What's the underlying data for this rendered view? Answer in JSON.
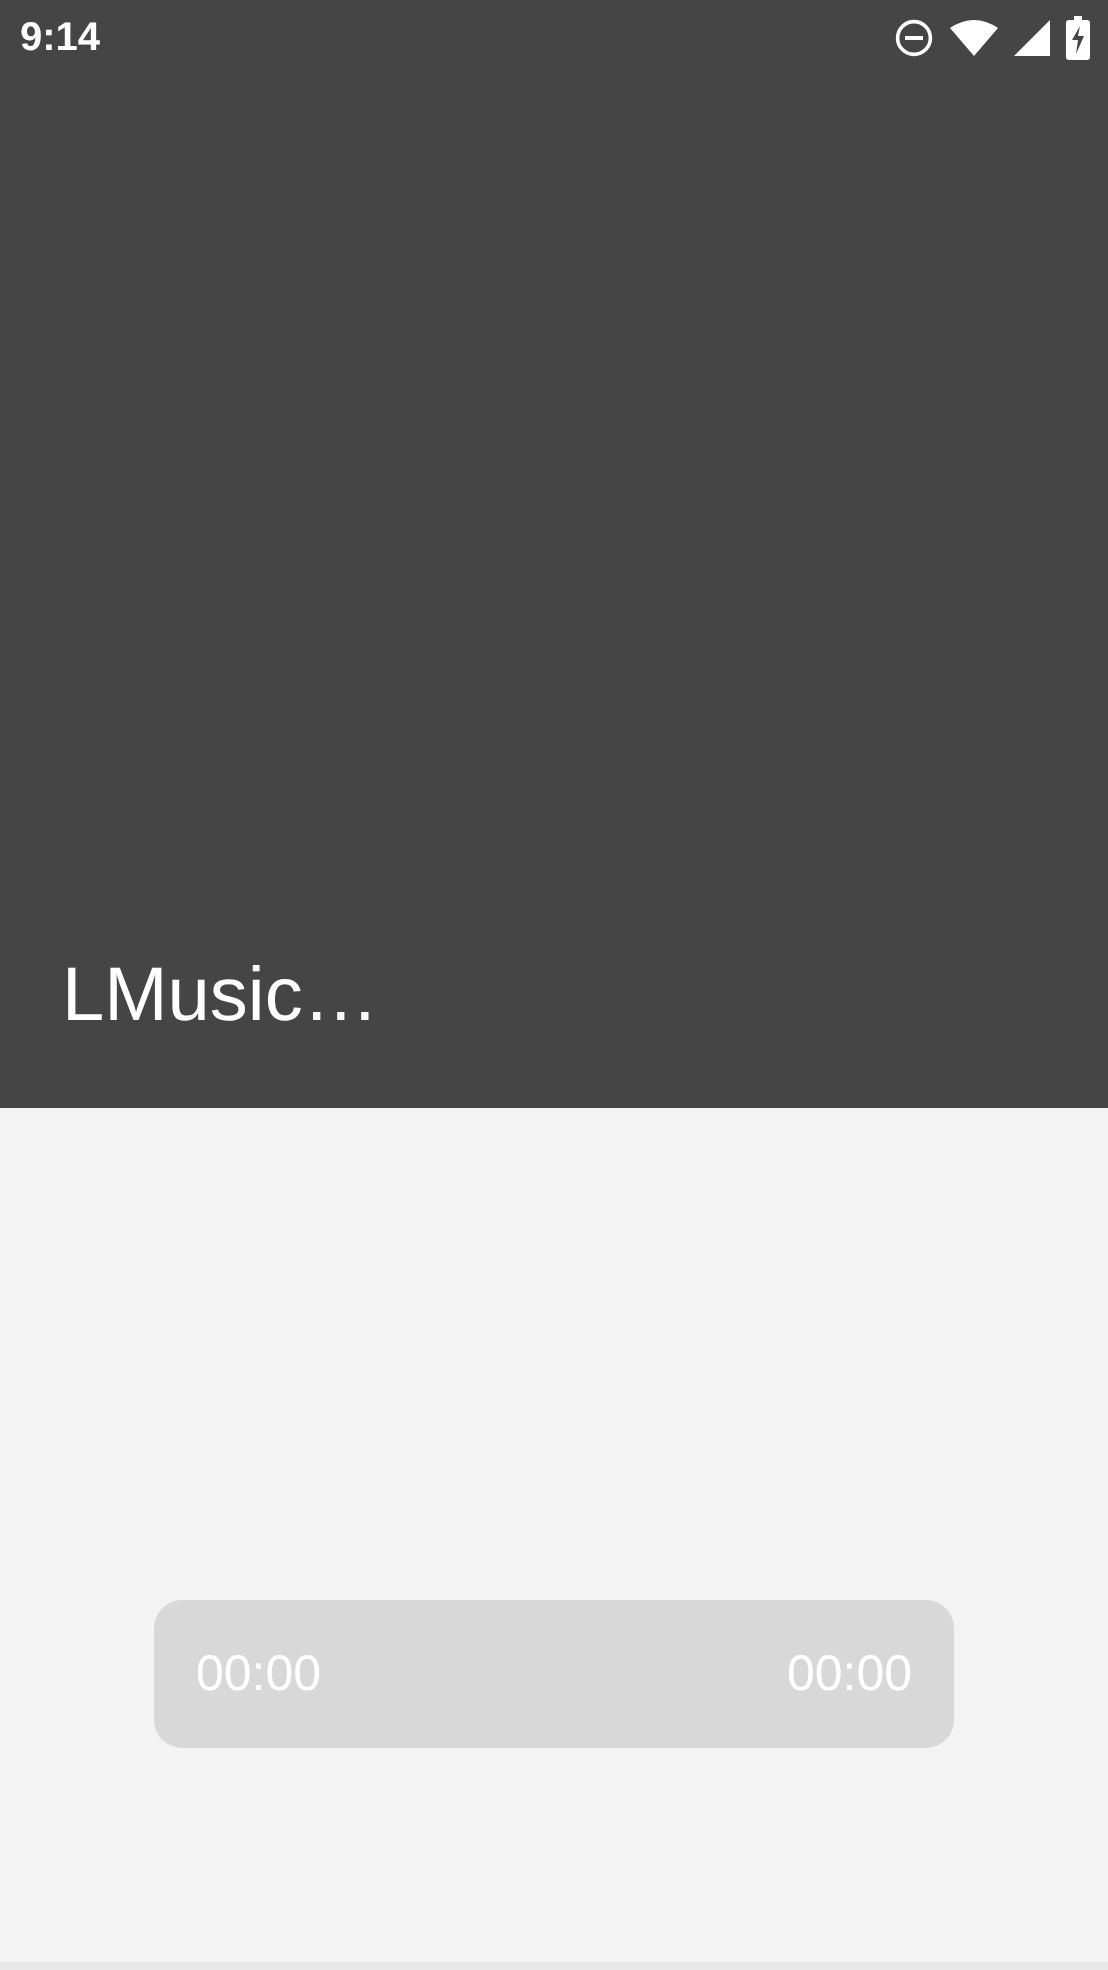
{
  "status_bar": {
    "time": "9:14"
  },
  "header": {
    "title": "LMusic…"
  },
  "player": {
    "elapsed": "00:00",
    "duration": "00:00"
  }
}
